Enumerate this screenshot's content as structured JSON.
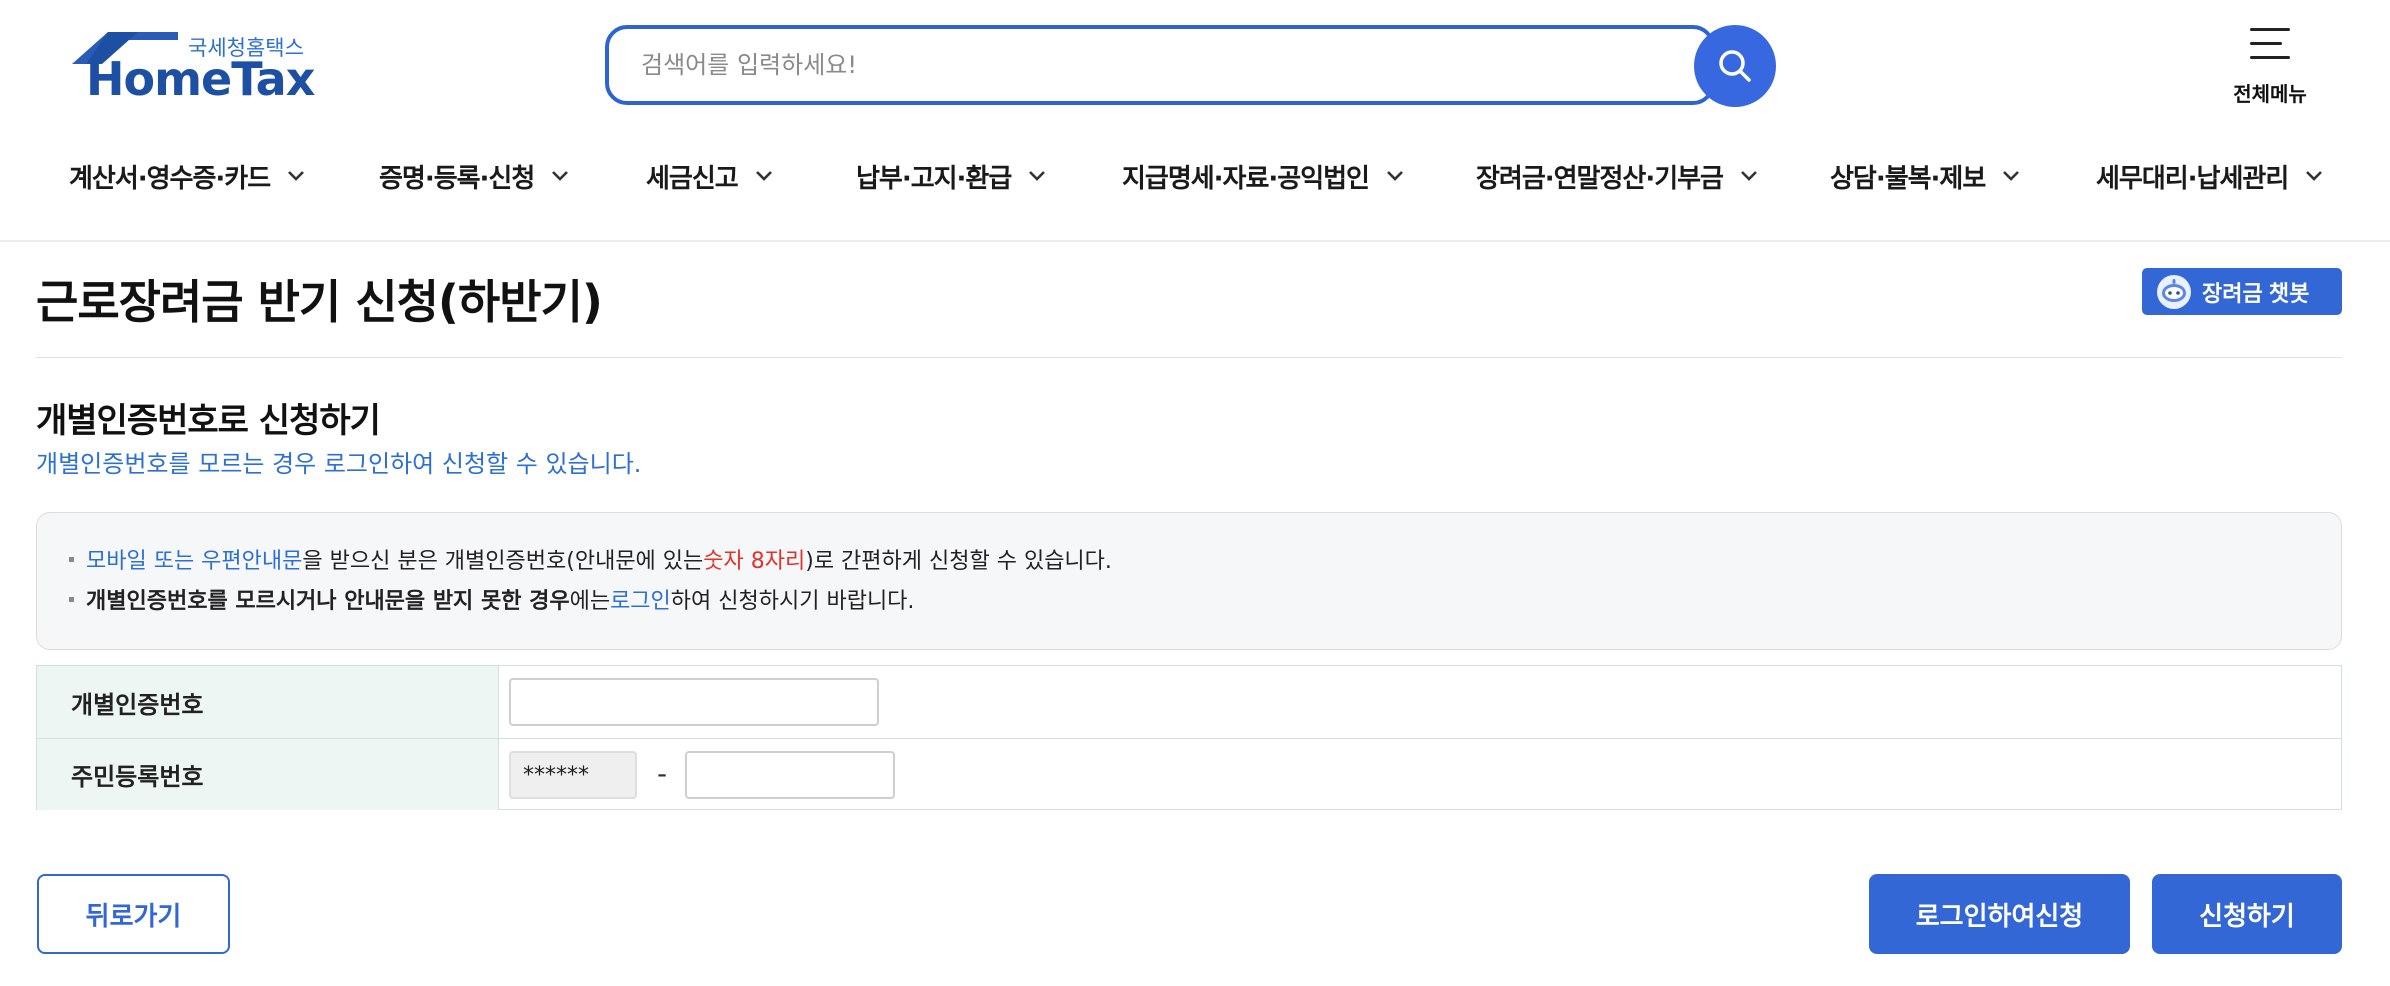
{
  "header": {
    "logo_sub": "국세청홈택스",
    "logo_main": "HomeTax",
    "search_placeholder": "검색어를 입력하세요!",
    "all_menu_label": "전체메뉴"
  },
  "gnb": [
    "계산서·영수증·카드",
    "증명·등록·신청",
    "세금신고",
    "납부·고지·환급",
    "지급명세·자료·공익법인",
    "장려금·연말정산·기부금",
    "상담·불복·제보",
    "세무대리·납세관리"
  ],
  "page": {
    "title": "근로장려금 반기 신청(하반기)",
    "chatbot_label": "장려금 챗봇"
  },
  "section": {
    "title": "개별인증번호로 신청하기",
    "desc": "개별인증번호를 모르는 경우 로그인하여 신청할 수 있습니다.",
    "notice1": {
      "a": "모바일 또는 우편안내문",
      "b": "을 받으신 분은 개별인증번호(안내문에 있는 ",
      "c": "숫자 8자리",
      "d": ")로 간편하게 신청할 수 있습니다."
    },
    "notice2": {
      "a": "개별인증번호를 모르시거나 안내문을 받지 못한 경우",
      "b": "에는 ",
      "c": "로그인",
      "d": "하여 신청하시기 바랍니다."
    }
  },
  "form": {
    "row1_label": "개별인증번호",
    "row1_value": "",
    "row2_label": "주민등록번호",
    "rrn_front": "******",
    "rrn_dash": "-",
    "rrn_back": ""
  },
  "buttons": {
    "back": "뒤로가기",
    "login_apply": "로그인하여신청",
    "apply": "신청하기"
  },
  "colors": {
    "primary": "#3367d6",
    "link_blue": "#2d6fd4",
    "highlight_red": "#e0332b",
    "table_header_bg": "#eef6f4"
  },
  "icons": {
    "search": "search-icon",
    "menu": "hamburger-icon",
    "chevron": "chevron-down-icon",
    "chatbot": "chatbot-icon"
  }
}
